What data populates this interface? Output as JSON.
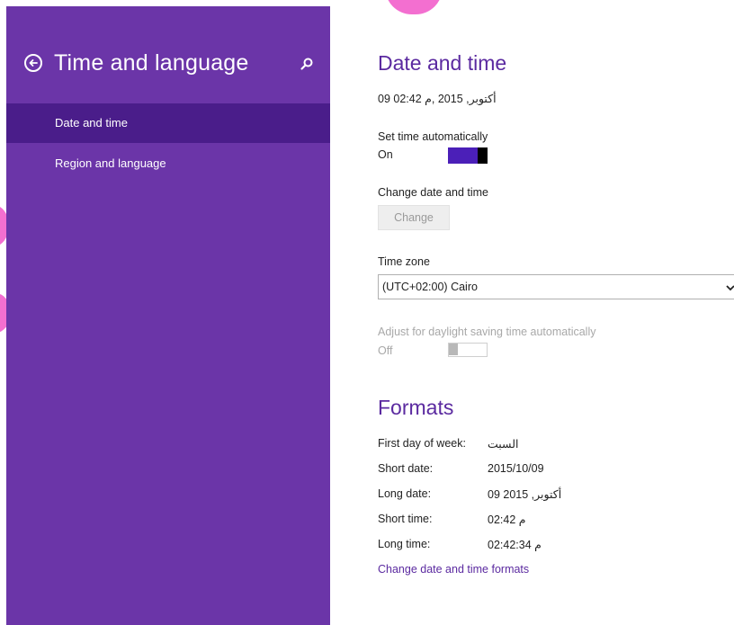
{
  "colors": {
    "sidebar_bg": "#6b35a8",
    "selected_bg": "#4a1d8a",
    "accent": "#5b2aa0",
    "toggle_on": "#4b1fb8",
    "decor_pink": "#f36fd0"
  },
  "sidebar": {
    "title": "Time and language",
    "back_icon": "back-arrow-circle-icon",
    "search_icon": "search-icon",
    "items": [
      {
        "label": "Date and time",
        "selected": true
      },
      {
        "label": "Region and language",
        "selected": false
      }
    ]
  },
  "date_time": {
    "heading": "Date and time",
    "current": "09 أكتوبر, 2015 ,م 02:42",
    "set_auto_label": "Set time automatically",
    "set_auto_state": "On",
    "change_label": "Change date and time",
    "change_button": "Change",
    "timezone_label": "Time zone",
    "timezone_value": "(UTC+02:00) Cairo",
    "dst_label": "Adjust for daylight saving time automatically",
    "dst_state": "Off"
  },
  "formats": {
    "heading": "Formats",
    "rows": [
      {
        "label": "First day of week:",
        "value": "السبت"
      },
      {
        "label": "Short date:",
        "value": "2015/10/09"
      },
      {
        "label": "Long date:",
        "value": "09 أكتوبر, 2015"
      },
      {
        "label": "Short time:",
        "value": "02:42 م"
      },
      {
        "label": "Long time:",
        "value": "02:42:34 م"
      }
    ],
    "link": "Change date and time formats"
  }
}
